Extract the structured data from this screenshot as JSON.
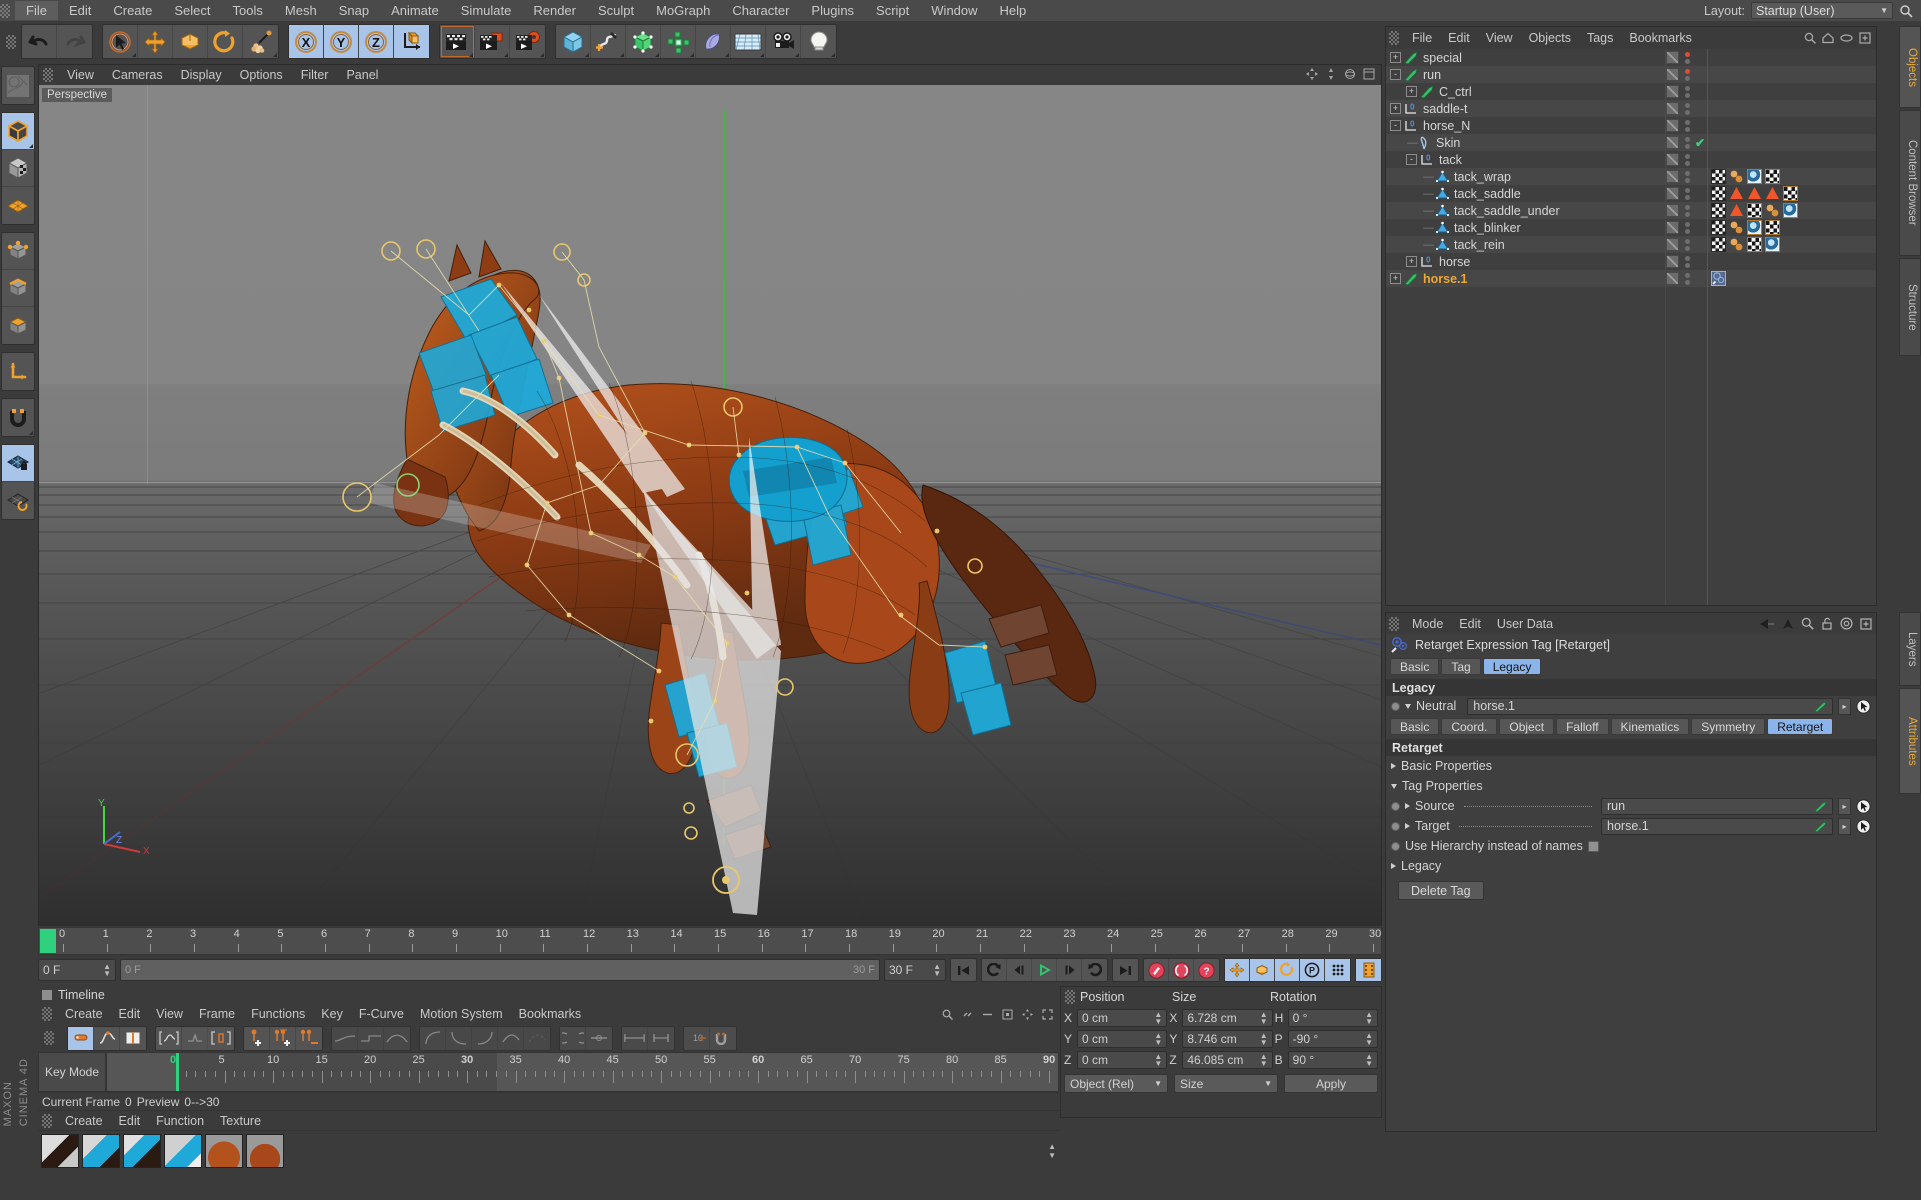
{
  "app": {
    "name": "CINEMA 4D",
    "vendor": "MAXON",
    "accent": "#e8a93a",
    "selection_blue": "#8bb4ea"
  },
  "menubar": {
    "items": [
      "File",
      "Edit",
      "Create",
      "Select",
      "Tools",
      "Mesh",
      "Snap",
      "Animate",
      "Simulate",
      "Render",
      "Sculpt",
      "MoGraph",
      "Character",
      "Plugins",
      "Script",
      "Window",
      "Help"
    ],
    "active": "File",
    "layout_label": "Layout:",
    "layout_value": "Startup (User)",
    "search_icon": "search-icon"
  },
  "main_toolbar": {
    "groups": [
      {
        "name": "history",
        "buttons": [
          {
            "icon": "undo-icon"
          },
          {
            "icon": "redo-icon"
          }
        ]
      },
      {
        "name": "tools",
        "buttons": [
          {
            "icon": "select-cursor-icon"
          },
          {
            "icon": "move-icon"
          },
          {
            "icon": "scale-icon"
          },
          {
            "icon": "rotate-icon"
          },
          {
            "icon": "magnet-icon"
          }
        ]
      },
      {
        "name": "axis-locks",
        "buttons": [
          {
            "icon": "axis-x-icon",
            "label": "X",
            "selected": true
          },
          {
            "icon": "axis-y-icon",
            "label": "Y",
            "selected": true
          },
          {
            "icon": "axis-z-icon",
            "label": "Z",
            "selected": true
          },
          {
            "icon": "world-coordinate-icon"
          }
        ]
      },
      {
        "name": "render",
        "buttons": [
          {
            "icon": "render-view-icon"
          },
          {
            "icon": "render-picture-viewer-icon"
          },
          {
            "icon": "render-settings-icon"
          }
        ]
      },
      {
        "name": "create",
        "buttons": [
          {
            "icon": "cube-primitive-icon"
          },
          {
            "icon": "spline-pen-icon"
          },
          {
            "icon": "generator-icon"
          },
          {
            "icon": "array-icon"
          },
          {
            "icon": "deformer-icon"
          },
          {
            "icon": "floor-scene-icon"
          },
          {
            "icon": "camera-icon"
          },
          {
            "icon": "light-icon"
          }
        ]
      }
    ]
  },
  "left_toolbar": {
    "groups": [
      {
        "buttons": [
          {
            "icon": "undo-view-icon"
          }
        ]
      },
      {
        "buttons": [
          {
            "icon": "model-mode-icon",
            "selected": true
          },
          {
            "icon": "texture-mode-icon"
          },
          {
            "icon": "points-deform-icon"
          }
        ]
      },
      {
        "buttons": [
          {
            "icon": "point-mode-icon"
          },
          {
            "icon": "edge-mode-icon"
          },
          {
            "icon": "polygon-mode-icon"
          }
        ]
      },
      {
        "buttons": [
          {
            "icon": "axis-modify-icon"
          }
        ]
      },
      {
        "buttons": [
          {
            "icon": "snap-magnet-icon"
          }
        ]
      },
      {
        "buttons": [
          {
            "icon": "workplane-lock-icon",
            "selected": true
          },
          {
            "icon": "workplane-rotate-icon"
          }
        ]
      }
    ]
  },
  "viewport": {
    "menu": [
      "View",
      "Cameras",
      "Display",
      "Options",
      "Filter",
      "Panel"
    ],
    "badge": "Perspective",
    "corner_icons": [
      "pan-view-icon",
      "zoom-view-icon",
      "rotate-view-icon",
      "maximize-view-icon"
    ],
    "axis_labels": {
      "x": "X",
      "y": "Y",
      "z": "Z"
    },
    "scene_description": "Rigged horse character with joints, IK handles and tack geometry in perspective view"
  },
  "anim_bar": {
    "ruler_start": 0,
    "ruler_end": 30,
    "ticks": [
      0,
      1,
      2,
      3,
      4,
      5,
      6,
      7,
      8,
      9,
      10,
      11,
      12,
      13,
      14,
      15,
      16,
      17,
      18,
      19,
      20,
      21,
      22,
      23,
      24,
      25,
      26,
      27,
      28,
      29,
      30
    ],
    "current_frame_field": "0 F",
    "scrub_left": "0 F",
    "scrub_right": "30 F",
    "end_frame_field": "30 F",
    "right_frame_field": "0 F",
    "transport": [
      "go-to-start-icon",
      "play-backwards-icon",
      "step-back-icon",
      "play-forward-icon",
      "step-forward-icon",
      "loop-icon",
      "go-to-end-icon"
    ],
    "record": [
      "record-key-icon",
      "autokey-icon",
      "keyframe-selection-icon"
    ],
    "key_toggles": [
      "key-position-icon",
      "key-scale-icon",
      "key-rotation-icon",
      "key-param-icon",
      "key-pla-icon",
      "key-all-icon"
    ]
  },
  "timeline": {
    "title": "Timeline",
    "menu": [
      "Create",
      "Edit",
      "View",
      "Frame",
      "Functions",
      "Key",
      "F-Curve",
      "Motion System",
      "Bookmarks"
    ],
    "header_icons": [
      "search-icon",
      "link-icon",
      "minus-icon",
      "frame-selection-icon",
      "move-icon",
      "fit-icon"
    ],
    "tool_groups": [
      [
        "key-mode-icon",
        "fcurve-mode-icon",
        "motion-mode-icon"
      ],
      [
        "auto-region-icon",
        "linear-region-icon",
        "box-region-icon"
      ],
      [
        "add-key-icon",
        "add-keys-icon",
        "remove-keys-icon"
      ],
      [
        "ease-flat-icon",
        "ease-step-icon",
        "ease-smooth-icon"
      ],
      [
        "tangent-soft-icon",
        "tangent-ease-in-icon",
        "tangent-ease-out-icon",
        "tangent-linear-icon",
        "tangent-break-icon"
      ],
      [
        "slide-icon",
        "zero-icon"
      ],
      [
        "stretch-icon",
        "shrink-icon"
      ],
      [
        "move-keys-icon",
        "snap-keys-icon"
      ]
    ],
    "mode_label": "Key Mode",
    "ruler_labels": [
      0,
      5,
      10,
      15,
      20,
      25,
      30,
      35,
      40,
      45,
      50,
      55,
      60,
      65,
      70,
      75,
      80,
      85,
      90
    ],
    "preview_range": "0-->30",
    "status_current_frame_label": "Current Frame",
    "status_current_frame_value": "0",
    "status_preview_label": "Preview",
    "playhead_frame": 0
  },
  "material_manager": {
    "menu": [
      "Create",
      "Edit",
      "Function",
      "Texture"
    ],
    "materials": [
      "mat-bridle-1",
      "mat-bridle-2",
      "mat-blinker",
      "mat-saddle-cloth",
      "mat-horse-body",
      "mat-horse-mane"
    ]
  },
  "coordinates": {
    "columns": [
      "Position",
      "Size",
      "Rotation"
    ],
    "rows": [
      {
        "pos_axis": "X",
        "pos_value": "0 cm",
        "size_axis": "X",
        "size_value": "6.728 cm",
        "rot_axis": "H",
        "rot_value": "0 °"
      },
      {
        "pos_axis": "Y",
        "pos_value": "0 cm",
        "size_axis": "Y",
        "size_value": "8.746 cm",
        "rot_axis": "P",
        "rot_value": "-90 °"
      },
      {
        "pos_axis": "Z",
        "pos_value": "0 cm",
        "size_axis": "Z",
        "size_value": "46.085 cm",
        "rot_axis": "B",
        "rot_value": "90 °"
      }
    ],
    "space_select": "Object (Rel)",
    "mode_select": "Size",
    "apply_button": "Apply"
  },
  "object_manager": {
    "menu": [
      "File",
      "Edit",
      "View",
      "Objects",
      "Tags",
      "Bookmarks"
    ],
    "header_icons": [
      "search-icon",
      "home-icon",
      "eye-icon",
      "add-layer-icon"
    ],
    "items": [
      {
        "name": "special",
        "indent": 0,
        "icon": "null-object-icon",
        "expander": "+",
        "dot": "red",
        "tags": []
      },
      {
        "name": "run",
        "indent": 0,
        "icon": "null-object-icon",
        "expander": "-",
        "dot": "red",
        "tags": []
      },
      {
        "name": "C_ctrl",
        "indent": 1,
        "icon": "null-object-icon",
        "expander": "+",
        "dot": "grey",
        "tags": []
      },
      {
        "name": "saddle-t",
        "indent": 0,
        "icon": "layer-object-icon",
        "expander": "+",
        "dot": "grey",
        "tags": []
      },
      {
        "name": "horse_N",
        "indent": 0,
        "icon": "layer-object-icon",
        "expander": "-",
        "dot": "grey",
        "tags": []
      },
      {
        "name": "Skin",
        "indent": 1,
        "icon": "skin-deformer-icon",
        "expander": "",
        "dot": "grey",
        "check": true,
        "tags": []
      },
      {
        "name": "tack",
        "indent": 1,
        "icon": "layer-object-icon",
        "expander": "-",
        "dot": "grey",
        "tags": []
      },
      {
        "name": "tack_wrap",
        "indent": 2,
        "icon": "polygon-object-icon",
        "expander": "",
        "dot": "grey",
        "tags": [
          "phong-tag",
          "uvw-tag",
          "texture-tag",
          "checker-tag"
        ]
      },
      {
        "name": "tack_saddle",
        "indent": 2,
        "icon": "polygon-object-icon",
        "expander": "",
        "dot": "grey",
        "tags": [
          "phong-tag",
          "selection-tag",
          "selection-tag",
          "selection-tag",
          "checker-tag"
        ]
      },
      {
        "name": "tack_saddle_under",
        "indent": 2,
        "icon": "polygon-object-icon",
        "expander": "",
        "dot": "grey",
        "tags": [
          "phong-tag",
          "selection-tag",
          "checker-tag",
          "uvw-tag",
          "texture-tag"
        ]
      },
      {
        "name": "tack_blinker",
        "indent": 2,
        "icon": "polygon-object-icon",
        "expander": "",
        "dot": "grey",
        "tags": [
          "phong-tag",
          "uvw-tag",
          "texture-tag",
          "checker-tag"
        ]
      },
      {
        "name": "tack_rein",
        "indent": 2,
        "icon": "polygon-object-icon",
        "expander": "",
        "dot": "grey",
        "tags": [
          "phong-tag",
          "uvw-tag",
          "checker-tag",
          "texture-tag"
        ]
      },
      {
        "name": "horse",
        "indent": 1,
        "icon": "layer-object-icon",
        "expander": "+",
        "dot": "grey",
        "tags": []
      },
      {
        "name": "horse.1",
        "indent": 0,
        "icon": "null-object-icon",
        "expander": "+",
        "dot": "grey",
        "selected": true,
        "tags": [
          "retarget-tag"
        ]
      }
    ]
  },
  "attribute_manager": {
    "menu": [
      "Mode",
      "Edit",
      "User Data"
    ],
    "header_icons": [
      "back-arrow-icon",
      "up-arrow-icon",
      "search-icon",
      "lock-icon",
      "target-icon",
      "add-icon"
    ],
    "title": "Retarget Expression Tag [Retarget]",
    "title_icon": "retarget-tag-icon",
    "top_tabs": [
      {
        "label": "Basic",
        "active": false
      },
      {
        "label": "Tag",
        "active": false
      },
      {
        "label": "Legacy",
        "active": true
      }
    ],
    "legacy_section": "Legacy",
    "neutral_label": "Neutral",
    "neutral_value": "horse.1",
    "sub_tabs": [
      {
        "label": "Basic",
        "active": false
      },
      {
        "label": "Coord.",
        "active": false
      },
      {
        "label": "Object",
        "active": false
      },
      {
        "label": "Falloff",
        "active": false
      },
      {
        "label": "Kinematics",
        "active": false
      },
      {
        "label": "Symmetry",
        "active": false
      },
      {
        "label": "Retarget",
        "active": true
      }
    ],
    "retarget_section": "Retarget",
    "groups": [
      {
        "label": "Basic Properties",
        "open": false
      },
      {
        "label": "Tag Properties",
        "open": true
      }
    ],
    "fields": [
      {
        "label": "Source",
        "value": "run",
        "type": "link"
      },
      {
        "label": "Target",
        "value": "horse.1",
        "type": "link"
      }
    ],
    "checkbox_label": "Use Hierarchy instead of names",
    "checkbox_checked": false,
    "legacy_group": "Legacy",
    "delete_button": "Delete Tag"
  },
  "side_tabs": {
    "top": [
      {
        "label": "Objects",
        "active": true
      },
      {
        "label": "Content Browser",
        "active": false
      },
      {
        "label": "Structure",
        "active": false
      }
    ],
    "bottom": [
      {
        "label": "Layers",
        "active": false
      },
      {
        "label": "Attributes",
        "active": true
      }
    ]
  }
}
